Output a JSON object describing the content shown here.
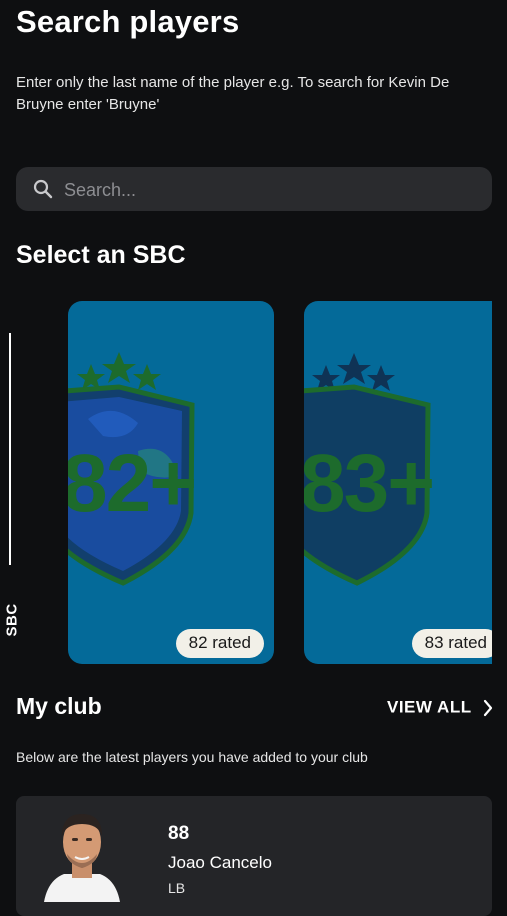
{
  "header": {
    "title": "Search players",
    "hint": "Enter only the last name of the player e.g. To search for Kevin De Bruyne enter 'Bruyne'"
  },
  "search": {
    "placeholder": "Search...",
    "value": ""
  },
  "sbc": {
    "section_title": "Select an SBC",
    "side_label": "SBC",
    "cards": [
      {
        "badge_text": "82+",
        "label": "82 rated",
        "color": "#046a99"
      },
      {
        "badge_text": "83+",
        "label": "83 rated",
        "color": "#046a99"
      }
    ]
  },
  "club": {
    "title": "My club",
    "view_all": "VIEW ALL",
    "subtitle": "Below are the latest players you have added to your club",
    "players": [
      {
        "rating": "88",
        "name": "Joao Cancelo",
        "position": "LB"
      }
    ]
  },
  "colors": {
    "background": "#0e0f11",
    "card": "#046a99",
    "badge_green": "#1d6b2c"
  }
}
